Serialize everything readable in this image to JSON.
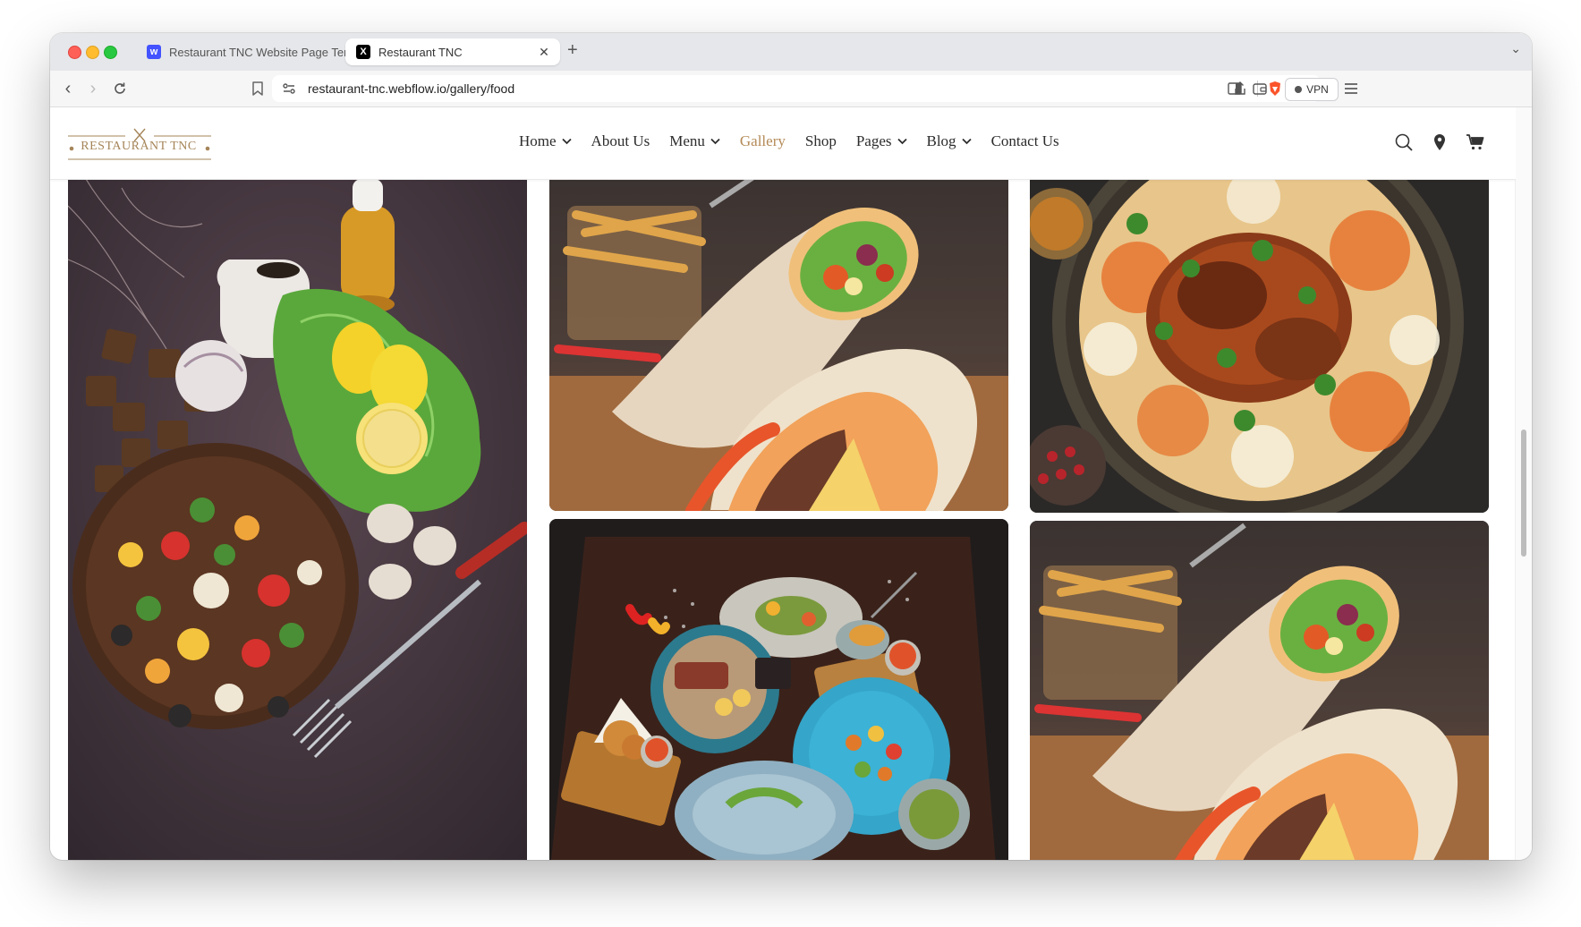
{
  "browser": {
    "tabs": [
      {
        "title": "Restaurant TNC Website Page Template",
        "favicon": "webflow-icon",
        "active": false
      },
      {
        "title": "Restaurant TNC",
        "favicon": "x-icon",
        "active": true
      }
    ],
    "new_tab_label": "+",
    "url": "restaurant-tnc.webflow.io/gallery/food",
    "vpn_label": "VPN"
  },
  "site": {
    "logo_text": "RESTAURANT TNC",
    "nav": [
      {
        "label": "Home",
        "dropdown": true
      },
      {
        "label": "About Us",
        "dropdown": false
      },
      {
        "label": "Menu",
        "dropdown": true
      },
      {
        "label": "Gallery",
        "dropdown": false,
        "active": true
      },
      {
        "label": "Shop",
        "dropdown": false
      },
      {
        "label": "Pages",
        "dropdown": true
      },
      {
        "label": "Blog",
        "dropdown": true
      },
      {
        "label": "Contact Us",
        "dropdown": false
      }
    ],
    "header_icons": [
      "search-icon",
      "location-pin-icon",
      "cart-icon"
    ],
    "accent_color": "#b48a57"
  },
  "gallery": {
    "photos": [
      {
        "subject": "pasta-salad"
      },
      {
        "subject": "shawarma-wrap"
      },
      {
        "subject": "chicken-biryani"
      },
      {
        "subject": "restaurant-platter"
      },
      {
        "subject": "shawarma-wrap"
      }
    ]
  }
}
